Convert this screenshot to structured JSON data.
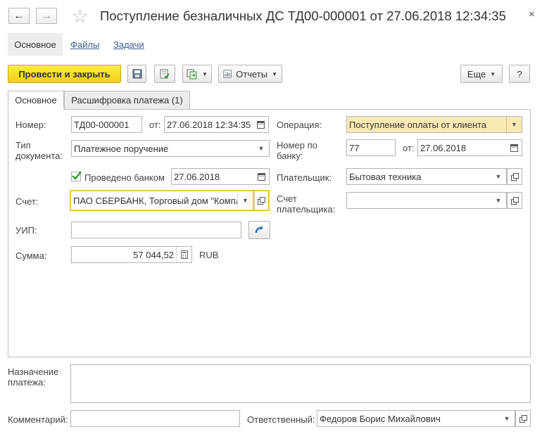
{
  "window": {
    "title": "Поступление безналичных ДС ТД00-000001 от 27.06.2018 12:34:35",
    "back_icon": "←",
    "forward_icon": "→",
    "star_icon": "☆",
    "close_icon": "×"
  },
  "nav_tabs": [
    {
      "label": "Основное"
    },
    {
      "label": "Файлы"
    },
    {
      "label": "Задачи"
    }
  ],
  "toolbar": {
    "post_close_label": "Провести и закрыть",
    "reports_label": "Отчеты",
    "more_label": "Еще",
    "help_label": "?"
  },
  "form_tabs": [
    {
      "label": "Основное"
    },
    {
      "label": "Расшифровка платежа (1)"
    }
  ],
  "form": {
    "number_label": "Номер:",
    "number_value": "ТД00-000001",
    "from_label": "от:",
    "date_value": "27.06.2018 12:34:35",
    "operation_label": "Операция:",
    "operation_value": "Поступление оплаты от клиента",
    "doc_type_label": "Тип документа:",
    "doc_type_value": "Платежное поручение",
    "bank_number_label": "Номер по банку:",
    "bank_number_value": "77",
    "bank_from_label": "от:",
    "bank_date_value": "27.06.2018",
    "bank_posted_label": "Проведено банком",
    "bank_posted_date": "27.06.2018",
    "payer_label": "Плательщик:",
    "payer_value": "Бытовая техника",
    "account_label": "Счет:",
    "account_value": "ПАО СБЕРБАНК, Торговый дом \"Комплексный\"",
    "payer_account_label": "Счет плательщика:",
    "payer_account_value": "",
    "uip_label": "УИП:",
    "uip_value": "",
    "sum_label": "Сумма:",
    "sum_value": "57 044,52",
    "currency": "RUB"
  },
  "bottom": {
    "purpose_label": "Назначение платежа:",
    "purpose_value": "",
    "comment_label": "Комментарий:",
    "comment_value": "",
    "responsible_label": "Ответственный:",
    "responsible_value": "Федоров Борис Михайлович"
  },
  "colors": {
    "primary_button": "#f5d420",
    "operation_field_bg": "#fbe9b3",
    "focused_field_border": "#e8c640",
    "link": "#3b5f8f"
  }
}
